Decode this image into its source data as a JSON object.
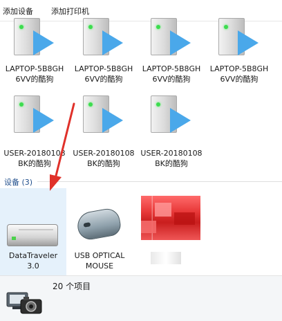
{
  "toolbar": {
    "add_device": "添加设备",
    "add_printer": "添加打印机"
  },
  "printers": [
    {
      "line1": "LAPTOP-5B8GH",
      "line2": "6VV的酷狗"
    },
    {
      "line1": "LAPTOP-5B8GH",
      "line2": "6VV的酷狗"
    },
    {
      "line1": "LAPTOP-5B8GH",
      "line2": "6VV的酷狗"
    },
    {
      "line1": "LAPTOP-5B8GH",
      "line2": "6VV的酷狗"
    },
    {
      "line1": "USER-20180108",
      "line2": "BK的酷狗"
    },
    {
      "line1": "USER-20180108",
      "line2": "BK的酷狗"
    },
    {
      "line1": "USER-20180108",
      "line2": "BK的酷狗"
    }
  ],
  "devices_group": {
    "label": "设备 (3)"
  },
  "devices": [
    {
      "line1": "DataTraveler",
      "line2": "3.0",
      "icon": "usb-drive-icon",
      "selected": true
    },
    {
      "line1": "USB OPTICAL",
      "line2": "MOUSE",
      "icon": "mouse-icon",
      "selected": false
    },
    {
      "line1": "",
      "line2": "",
      "icon": "blurred-device-icon",
      "selected": false
    }
  ],
  "status": {
    "item_count": "20 个项目"
  },
  "colors": {
    "selection": "#e5f1fb",
    "group_label": "#1f4e8c",
    "annotation_arrow": "#e0312a",
    "play_arrow": "#4aa8ea"
  }
}
